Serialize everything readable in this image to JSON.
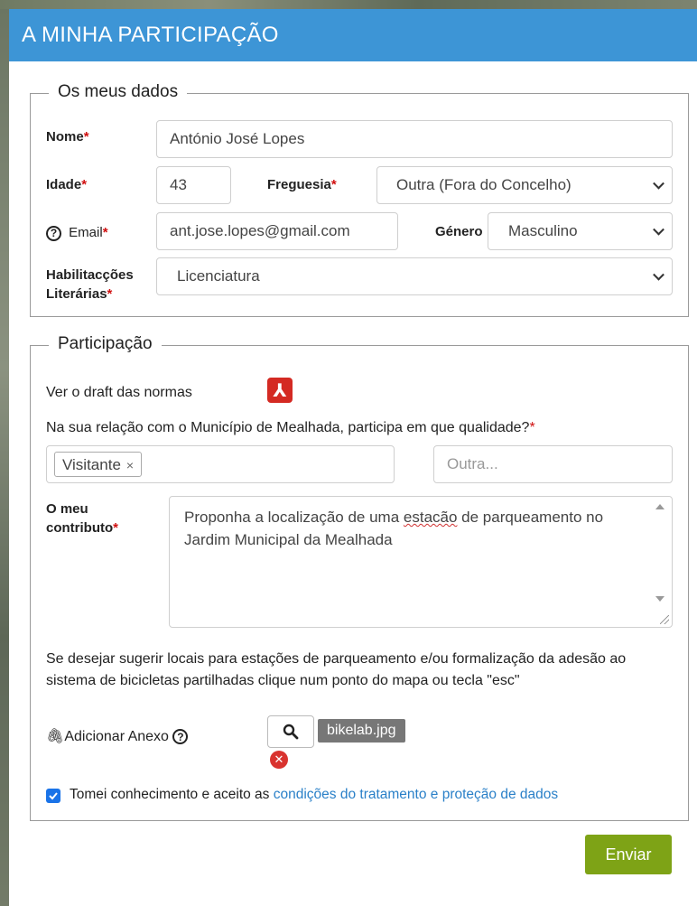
{
  "header": {
    "title": "A MINHA PARTICIPAÇÃO"
  },
  "dados": {
    "legend": "Os meus dados",
    "nome": {
      "label": "Nome",
      "value": "António José Lopes"
    },
    "idade": {
      "label": "Idade",
      "value": "43"
    },
    "freguesia": {
      "label": "Freguesia",
      "value": "Outra (Fora do Concelho)"
    },
    "email": {
      "label": "Email",
      "value": "ant.jose.lopes@gmail.com"
    },
    "genero": {
      "label": "Género",
      "value": "Masculino"
    },
    "habilitacoes": {
      "label_line1": "Habilitacções",
      "label_line2": "Literárias",
      "value": "Licenciatura"
    },
    "required_mark": "*"
  },
  "participacao": {
    "legend": "Participação",
    "draft_label": "Ver o draft das normas",
    "question": "Na sua relação com o Município de Mealhada, participa em que qualidade?",
    "tag": "Visitante",
    "tag_remove": "×",
    "outra_placeholder": "Outra...",
    "contributo": {
      "label_line1": "O meu",
      "label_line2": "contributo",
      "text_part1": "Proponha a localização de uma ",
      "text_misspelled": "estacão",
      "text_part2": " de parqueamento no Jardim Municipal da Mealhada"
    },
    "map_instructions": "Se desejar sugerir locais para estações de parqueamento e/ou formalização da adesão ao sistema de bicicletas partilhadas clique num ponto do mapa ou tecla \"esc\"",
    "anexo_label": "Adicionar Anexo",
    "file_name": "bikelab.jpg",
    "consent_text": "Tomei conhecimento e aceito as ",
    "consent_link": "condições do tratamento e proteção de dados",
    "consent_checked": true
  },
  "submit_label": "Enviar",
  "colors": {
    "header": "#3d95d6",
    "submit": "#7ea316",
    "required": "#d01010",
    "link": "#2a80c8"
  }
}
